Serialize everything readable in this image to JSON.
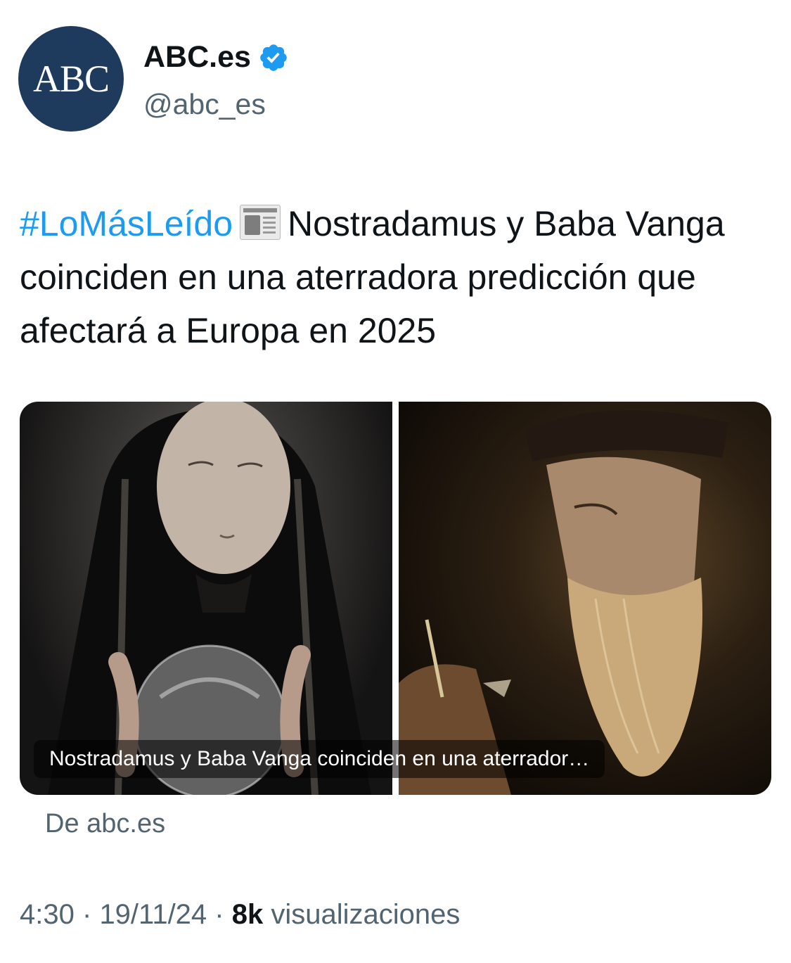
{
  "account": {
    "avatar_text": "ABC",
    "display_name": "ABC.es",
    "handle": "@abc_es",
    "verified": true,
    "avatar_color": "#1e3a5c",
    "verified_color": "#1d9bf0"
  },
  "tweet": {
    "hashtag": "#LoMásLeído",
    "emoji_icon": "newspaper-icon",
    "text": "Nostradamus y Baba Vanga coinciden en una aterradora predicción que afectará a Europa en 2025"
  },
  "card": {
    "caption": "Nostradamus y Baba Vanga coinciden en una aterrador…",
    "source": "De abc.es"
  },
  "meta": {
    "time": "4:30",
    "date": "19/11/24",
    "views_count": "8k",
    "views_label": "visualizaciones",
    "separator": "·"
  }
}
